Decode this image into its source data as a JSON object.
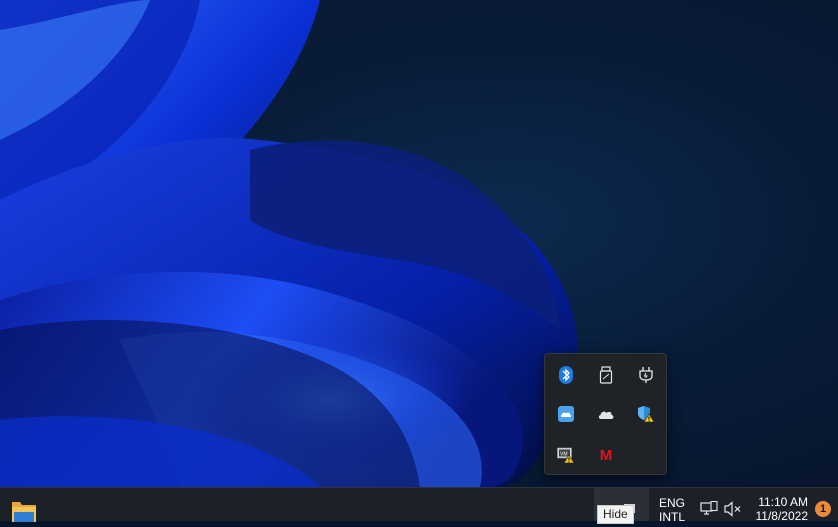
{
  "tray_flyout": {
    "icons": [
      {
        "name": "bluetooth-icon"
      },
      {
        "name": "usb-drive-icon"
      },
      {
        "name": "power-plug-icon"
      },
      {
        "name": "onedrive-app-icon"
      },
      {
        "name": "onedrive-cloud-icon"
      },
      {
        "name": "defender-warning-icon"
      },
      {
        "name": "vm-warning-icon"
      },
      {
        "name": "m-app-icon",
        "label": "M"
      }
    ]
  },
  "taskbar": {
    "tooltip": "Hide",
    "language": {
      "line1": "ENG",
      "line2": "INTL"
    },
    "clock": {
      "time": "11:10 AM",
      "date": "11/8/2022"
    },
    "notification_count": "1"
  },
  "colors": {
    "taskbar_bg": "#1c2129",
    "flyout_bg": "#1f2226",
    "accent_blue": "#1e7be6",
    "badge": "#e98a3c",
    "m_red": "#e0161b"
  }
}
